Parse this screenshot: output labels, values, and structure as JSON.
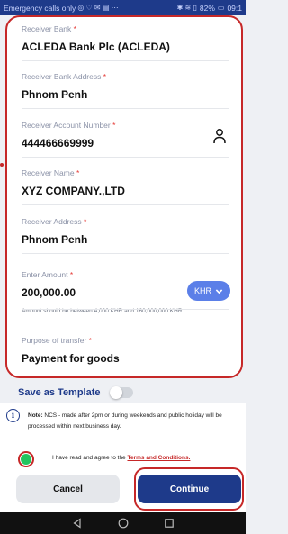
{
  "statusbar": {
    "left_text": "Emergency calls only",
    "battery": "82%",
    "time": "09:1"
  },
  "fields": [
    {
      "label": "Receiver Bank",
      "required": "*",
      "value": "ACLEDA Bank Plc (ACLEDA)"
    },
    {
      "label": "Receiver Bank Address",
      "required": "*",
      "value": "Phnom Penh"
    },
    {
      "label": "Receiver Account Number",
      "required": "*",
      "value": "444466669999"
    },
    {
      "label": "Receiver Name",
      "required": "*",
      "value": "XYZ COMPANY.,LTD"
    },
    {
      "label": "Receiver Address",
      "required": "*",
      "value": "Phnom Penh"
    },
    {
      "label": "Enter Amount",
      "required": "*",
      "value": "200,000.00",
      "currency": "KHR",
      "hint": "Amount should be between 4,000 KHR and 160,000,000 KHR"
    },
    {
      "label": "Purpose of transfer",
      "required": "*",
      "value": "Payment for goods"
    }
  ],
  "template": {
    "label": "Save as Template",
    "enabled": false
  },
  "note": {
    "prefix": "Note:",
    "text": " NCS - made after 2pm or during weekends and public holiday will be processed within next business day."
  },
  "agreement": {
    "text": "I have read and agree to the ",
    "link": "Terms and Conditions."
  },
  "buttons": {
    "cancel": "Cancel",
    "continue": "Continue"
  },
  "colors": {
    "primary": "#1e3a8a",
    "accent": "#5b7fe8",
    "highlight": "#c62828",
    "checked": "#22c55e"
  }
}
